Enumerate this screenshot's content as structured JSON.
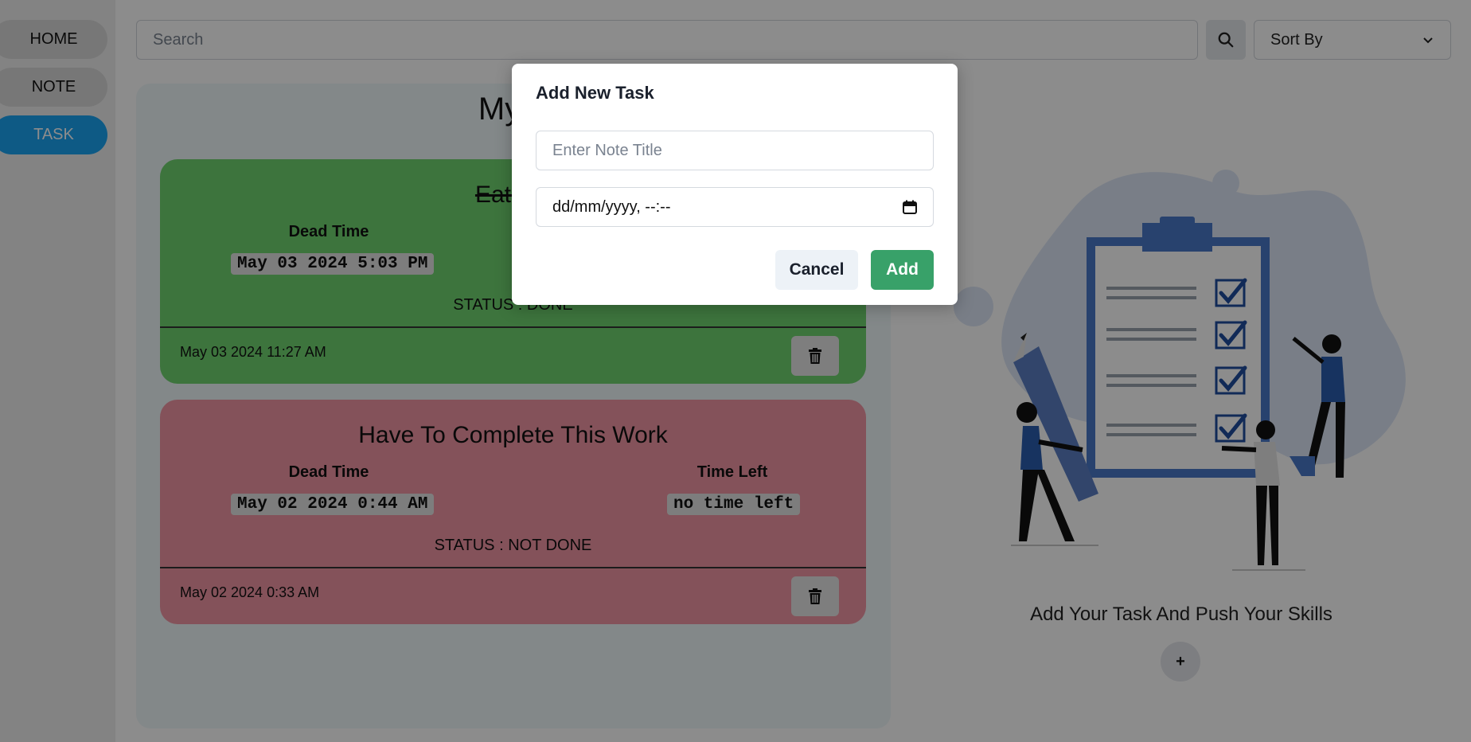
{
  "sidebar": {
    "items": [
      {
        "label": "HOME"
      },
      {
        "label": "NOTE"
      },
      {
        "label": "TASK"
      }
    ]
  },
  "header": {
    "search_placeholder": "Search",
    "sort_label": "Sort By"
  },
  "main": {
    "title": "My T",
    "tasks": [
      {
        "title": "Eat Mo",
        "dead_time_label": "Dead Time",
        "dead_time": "May 03 2024 5:03 PM",
        "status": "STATUS : DONE",
        "created": "May 03 2024 11:27 AM",
        "color": "#6fd36f"
      },
      {
        "title": "Have To Complete This Work",
        "dead_time_label": "Dead Time",
        "dead_time": "May 02 2024 0:44 AM",
        "time_left_label": "Time Left",
        "time_left": "no time left",
        "status": "STATUS : NOT DONE",
        "created": "May 02 2024 0:33 AM",
        "color": "#f195a4"
      }
    ]
  },
  "right": {
    "tagline": "Add Your Task And Push Your Skills",
    "add_label": "+"
  },
  "modal": {
    "title": "Add New Task",
    "title_placeholder": "Enter Note Title",
    "date_placeholder": "dd/mm/yyyy, --:--",
    "cancel_label": "Cancel",
    "add_label": "Add"
  },
  "colors": {
    "accent": "#1ba4f2",
    "add_button": "#38a169",
    "done": "#6fd36f",
    "not_done": "#f195a4"
  }
}
